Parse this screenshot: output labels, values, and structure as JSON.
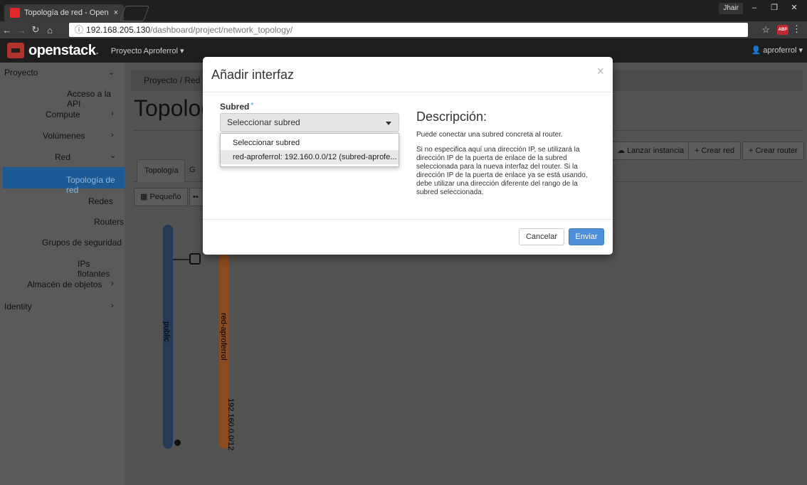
{
  "browser": {
    "tab_title": "Topología de red - Open",
    "tab_close": "×",
    "user_badge": "Jhair",
    "url_host": "192.168.205.130",
    "url_path": "/dashboard/project/network_topology/",
    "star_icon": "star-icon",
    "abp_label": "ABP"
  },
  "header": {
    "logo_text": "openstack",
    "logo_dot": ".",
    "project_menu": "Proyecto Aproferrol ▾",
    "user_menu": "aproferrol ▾"
  },
  "sidebar": {
    "items": [
      {
        "label": "Proyecto"
      },
      {
        "label": "Acceso a la API"
      },
      {
        "label": "Compute"
      },
      {
        "label": "Volúmenes"
      },
      {
        "label": "Red"
      },
      {
        "label": "Topología de red"
      },
      {
        "label": "Redes"
      },
      {
        "label": "Routers"
      },
      {
        "label": "Grupos de seguridad"
      },
      {
        "label": "IPs flotantes"
      },
      {
        "label": "Almacén de objetos"
      },
      {
        "label": "Identity"
      }
    ]
  },
  "main": {
    "breadcrumb": "Proyecto /  Red /",
    "page_title": "Topologí",
    "buttons": {
      "launch_instance": "Lanzar instancia",
      "create_network": "+ Crear red",
      "create_router": "+ Crear router"
    },
    "tabs": {
      "topology": "Topología",
      "graph": "G"
    },
    "size_small": "Pequeño"
  },
  "topology": {
    "networks": [
      {
        "name": "public",
        "color": "#233b58"
      },
      {
        "name": "red-aproferrol",
        "color": "#8a4b1e",
        "cidr": "192.160.0.0/12"
      }
    ]
  },
  "modal": {
    "title": "Añadir interfaz",
    "close": "×",
    "field_label": "Subred",
    "required_mark": "*",
    "select_value": "Seleccionar subred",
    "options": [
      "Seleccionar subred",
      "red-aproferrol: 192.160.0.0/12 (subred-aprofe..."
    ],
    "description_title": "Descripción:",
    "description_p1": "Puede conectar una subred concreta al router.",
    "description_p2": "Si no especifica aquí una dirección IP, se utilizará la dirección IP de la puerta de enlace de la subred seleccionada para la nueva interfaz del router. Si la dirección IP de la puerta de enlace ya se está usando, debe utilizar una dirección diferente del rango de la subred seleccionada.",
    "cancel": "Cancelar",
    "submit": "Enviar"
  }
}
